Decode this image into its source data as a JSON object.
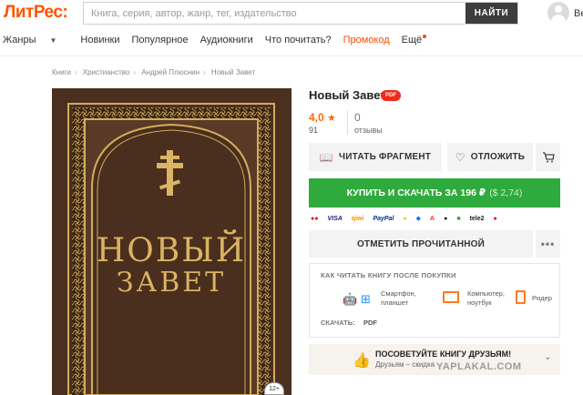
{
  "header": {
    "logo_left": "Лит",
    "logo_right": "Рес:",
    "search_placeholder": "Книга, серия, автор, жанр, тег, издательство",
    "search_button": "НАЙТИ",
    "user_label": "Be"
  },
  "nav": {
    "items": [
      "Жанры",
      "Новинки",
      "Популярное",
      "Аудиокниги",
      "Что почитать?",
      "Промокод",
      "Ещё"
    ],
    "promo_color": "#ff4d00"
  },
  "breadcrumb": [
    "Книги",
    "Христианство",
    "Андрей Плюснин",
    "Новый Завет"
  ],
  "cover": {
    "line1": "НОВЫЙ",
    "line2": "ЗАВЕТ",
    "age": "12+"
  },
  "book": {
    "title": "Новый Завет",
    "format_badge": "PDF",
    "rating": "4,0",
    "rating_count": "91",
    "reviews": "0",
    "reviews_label": "отзывы"
  },
  "actions": {
    "read": "ЧИТАТЬ ФРАГМЕНТ",
    "wish": "ОТЛОЖИТЬ",
    "buy": "КУПИТЬ И СКАЧАТЬ ЗА 196 ₽",
    "buy_alt": "($ 2,74)",
    "mark_read": "ОТМЕТИТЬ ПРОЧИТАННОЙ",
    "more": "•••"
  },
  "payments": [
    "●●",
    "VISA",
    "qiwi",
    "PayPal",
    "●",
    "◆",
    "A",
    "●",
    "■",
    "tele2",
    "●"
  ],
  "how": {
    "heading": "КАК ЧИТАТЬ КНИГУ ПОСЛЕ ПОКУПКИ",
    "phone": "Смартфон,",
    "phone2": "планшет",
    "pc": "Компьютер,",
    "pc2": "ноутбук",
    "reader": "Ридер",
    "download_label": "СКАЧАТЬ:",
    "download_format": "PDF"
  },
  "recommend": {
    "title": "ПОСОВЕТУЙТЕ КНИГУ ДРУЗЬЯМ!",
    "subtitle": "Друзьям – скидка"
  },
  "watermark": "YAPLAKAL.COM",
  "colors": {
    "accent": "#ff5500",
    "buy": "#2faa3c",
    "gold": "#c9a355",
    "cover_bg": "#4a3020"
  }
}
